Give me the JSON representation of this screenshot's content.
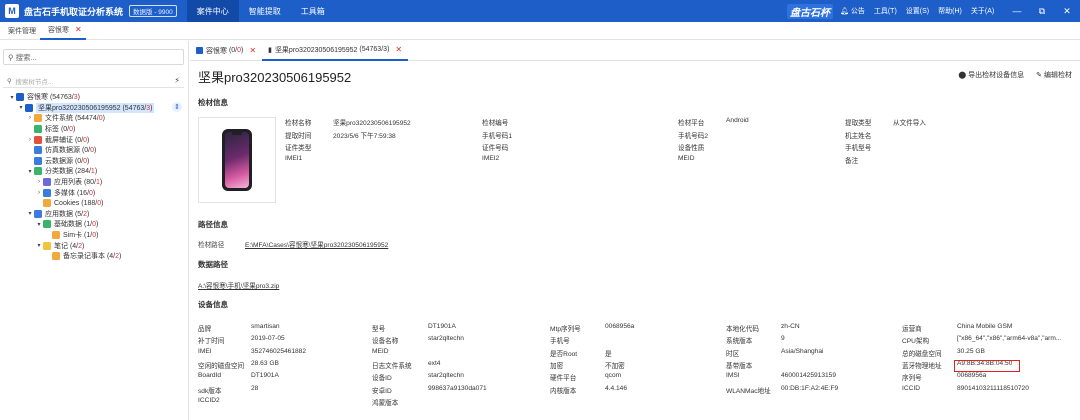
{
  "app": {
    "name": "盘古石手机取证分析系统",
    "edition": "数据版 - 9900",
    "brand": "盘古石杯"
  },
  "topnav": [
    "案件中心",
    "智能提取",
    "工具箱"
  ],
  "titlebar_right": {
    "notice": "公告",
    "tools": "工具(T)",
    "settings": "设置(S)",
    "help": "帮助(H)",
    "about": "关于(A)"
  },
  "window_controls": {
    "minimize": "—",
    "restore": "⧉",
    "close": "✕"
  },
  "doctabs": [
    "案件管理",
    "容恨寒"
  ],
  "left": {
    "search_placeholder": "搜索...",
    "filter_placeholder": "搜索树节点...",
    "tree": [
      {
        "caret": "▾",
        "label": "容恨寒",
        "cnt": "(54763/",
        "red": "3",
        "end": ")",
        "depth": 0,
        "color": "#1d5ec8"
      },
      {
        "caret": "▾",
        "label": "坚果pro320230506195952",
        "cnt": "(54763/",
        "red": "3",
        "end": ")",
        "depth": 1,
        "color": "#1d5ec8",
        "sel": true
      },
      {
        "caret": "›",
        "label": "文件系统",
        "cnt": "(54474/",
        "red": "0",
        "end": ")",
        "depth": 2,
        "color": "#f2a93b"
      },
      {
        "caret": "",
        "label": "标签",
        "cnt": "(0/",
        "red": "0",
        "end": ")",
        "depth": 2,
        "color": "#3bb36b"
      },
      {
        "caret": "›",
        "label": "截屏辅证",
        "cnt": "(0/",
        "red": "0",
        "end": ")",
        "depth": 2,
        "color": "#e0533b"
      },
      {
        "caret": "",
        "label": "仿真数据源",
        "cnt": "(0/",
        "red": "0",
        "end": ")",
        "depth": 2,
        "color": "#3a7be0"
      },
      {
        "caret": "",
        "label": "云数据源",
        "cnt": "(0/",
        "red": "0",
        "end": ")",
        "depth": 2,
        "color": "#3a7be0"
      },
      {
        "caret": "▾",
        "label": "分类数据",
        "cnt": "(284/",
        "red": "1",
        "end": ")",
        "depth": 2,
        "color": "#3bb36b"
      },
      {
        "caret": "›",
        "label": "应用列表",
        "cnt": "(80/",
        "red": "1",
        "end": ")",
        "depth": 3,
        "color": "#6b6bd8"
      },
      {
        "caret": "›",
        "label": "多媒体",
        "cnt": "(16/",
        "red": "0",
        "end": ")",
        "depth": 3,
        "color": "#3a7be0"
      },
      {
        "caret": "",
        "label": "Cookies",
        "cnt": "(188/",
        "red": "0",
        "end": ")",
        "depth": 3,
        "color": "#f2a93b"
      },
      {
        "caret": "▾",
        "label": "应用数据",
        "cnt": "(5/",
        "red": "2",
        "end": ")",
        "depth": 2,
        "color": "#3a7be0"
      },
      {
        "caret": "▾",
        "label": "基础数据",
        "cnt": "(1/",
        "red": "0",
        "end": ")",
        "depth": 3,
        "color": "#3bb36b"
      },
      {
        "caret": "",
        "label": "Sim卡",
        "cnt": "(1/",
        "red": "0",
        "end": ")",
        "depth": 4,
        "color": "#f2a93b"
      },
      {
        "caret": "▾",
        "label": "笔记",
        "cnt": "(4/",
        "red": "2",
        "end": ")",
        "depth": 3,
        "color": "#f2c43b"
      },
      {
        "caret": "",
        "label": "备忘录记事本",
        "cnt": "(4/",
        "red": "2",
        "end": ")",
        "depth": 4,
        "color": "#f2a93b"
      }
    ]
  },
  "innertabs": [
    {
      "label": "容恨寒",
      "cnt": "(0/",
      "red": "0",
      "end": ")"
    },
    {
      "label": "坚果pro320230506195952",
      "cnt": "(54763/",
      "red": "3",
      "end": ")"
    }
  ],
  "device_title": "坚果pro320230506195952",
  "actions": {
    "export": "导出检材设备信息",
    "edit": "编辑检材"
  },
  "sections": {
    "material": "检材信息",
    "path": "路径信息",
    "datapath": "数据路径",
    "device": "设备信息"
  },
  "material": [
    [
      "检材名称",
      "坚果pro320230506195952",
      "检材编号",
      "",
      "检材平台",
      "Android",
      "提取类型",
      "从文件导入"
    ],
    [
      "提取时间",
      "2023/5/6 下午7:59:38",
      "手机号码1",
      "",
      "手机号码2",
      "",
      "机主姓名",
      ""
    ],
    [
      "证件类型",
      "",
      "证件号码",
      "",
      "设备性质",
      "",
      "手机型号",
      ""
    ],
    [
      "IMEI1",
      "",
      "IMEI2",
      "",
      "MEID",
      "",
      "备注",
      ""
    ]
  ],
  "path": {
    "label": "检材路径",
    "value": "E:\\MFA\\Cases\\容恨寒\\坚果pro320230506195952"
  },
  "datapath": {
    "value": "A:\\容恨寒\\手机\\坚果pro3.zip"
  },
  "device": [
    [
      "品牌",
      "smartisan",
      "型号",
      "DT1901A",
      "Mtp序列号",
      "0068956a",
      "本地化代码",
      "zh-CN",
      "运营商",
      "China Mobile GSM"
    ],
    [
      "补丁时间",
      "2019-07-05",
      "设备名称",
      "star2qltechn",
      "手机号",
      "",
      "系统版本",
      "9",
      "CPU架构",
      "[\"x86_64\",\"x86\",\"arm64-v8a\",\"arm..."
    ],
    [
      "IMEI",
      "352746025461882",
      "MEID",
      "",
      "是否Root",
      "是",
      "时区",
      "Asia/Shanghai",
      "总的磁盘空间",
      "30.25 GB"
    ],
    [
      "空闲的磁盘空间",
      "28.63 GB",
      "日志文件系统",
      "ext4",
      "加密",
      "不加密",
      "基带版本",
      "",
      "蓝牙物理地址",
      "A9:8B:34:8B:04:50"
    ],
    [
      "BoardId",
      "DT1901A",
      "设备ID",
      "star2qltechn",
      "硬件平台",
      "qcom",
      "IMSI",
      "460001425913159",
      "序列号",
      "0068956a"
    ],
    [
      "sdk版本",
      "28",
      "安卓ID",
      "998637a9130da071",
      "内核版本",
      "4.4.146",
      "WLANMac地址",
      "00:DB:1F:A2:4E:F9",
      "ICCID",
      "89014103211118510720"
    ],
    [
      "ICCID2",
      "",
      "鸿蒙版本",
      "",
      "",
      "",
      "",
      "",
      "",
      ""
    ]
  ]
}
